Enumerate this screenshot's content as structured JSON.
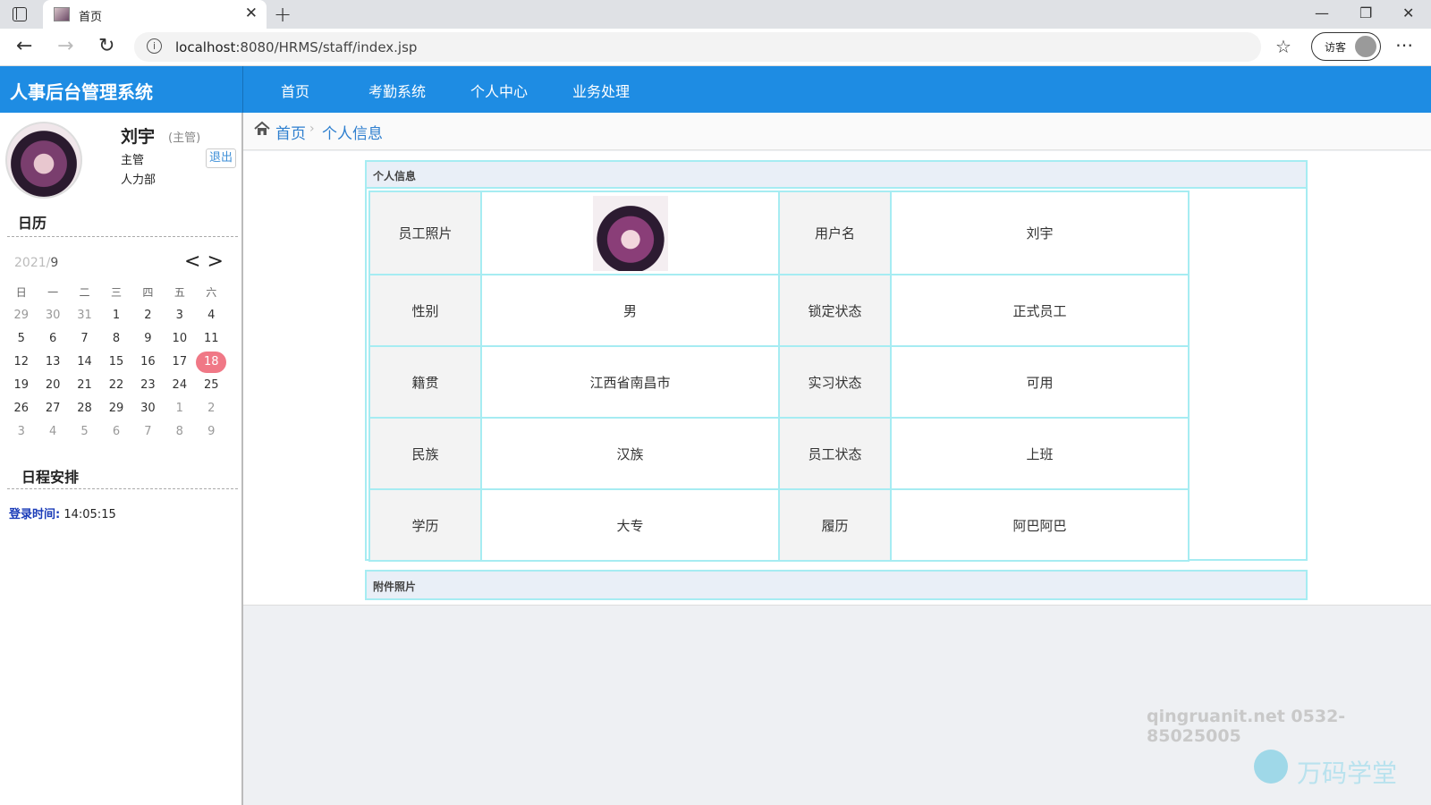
{
  "browser": {
    "tab_title": "首页",
    "url_host": "localhost",
    "url_path": ":8080/HRMS/staff/index.jsp",
    "profile_label": "访客"
  },
  "app": {
    "title": "人事后台管理系统",
    "nav": [
      "首页",
      "考勤系统",
      "个人中心",
      "业务处理"
    ]
  },
  "user": {
    "name": "刘宇",
    "role_tag": "(主管)",
    "role": "主管",
    "dept": "人力部",
    "logout": "退出"
  },
  "calendar": {
    "title": "日历",
    "year": "2021/",
    "month": "9",
    "prev": "<",
    "next": ">",
    "weekdays": [
      "日",
      "一",
      "二",
      "三",
      "四",
      "五",
      "六"
    ],
    "weeks": [
      [
        "29",
        "30",
        "31",
        "1",
        "2",
        "3",
        "4"
      ],
      [
        "5",
        "6",
        "7",
        "8",
        "9",
        "10",
        "11"
      ],
      [
        "12",
        "13",
        "14",
        "15",
        "16",
        "17",
        "18"
      ],
      [
        "19",
        "20",
        "21",
        "22",
        "23",
        "24",
        "25"
      ],
      [
        "26",
        "27",
        "28",
        "29",
        "30",
        "1",
        "2"
      ],
      [
        "3",
        "4",
        "5",
        "6",
        "7",
        "8",
        "9"
      ]
    ],
    "today": "18"
  },
  "schedule": {
    "title": "日程安排",
    "login_label": "登录时间:",
    "login_time": "14:05:15"
  },
  "breadcrumb": {
    "home": "首页",
    "current": "个人信息"
  },
  "info_panel": {
    "title": "个人信息",
    "photo_label": "员工照片",
    "rows": [
      {
        "l1": "员工照片",
        "v1": "",
        "l2": "用户名",
        "v2": "刘宇"
      },
      {
        "l1": "性别",
        "v1": "男",
        "l2": "锁定状态",
        "v2": "正式员工"
      },
      {
        "l1": "籍贯",
        "v1": "江西省南昌市",
        "l2": "实习状态",
        "v2": "可用"
      },
      {
        "l1": "民族",
        "v1": "汉族",
        "l2": "员工状态",
        "v2": "上班"
      },
      {
        "l1": "学历",
        "v1": "大专",
        "l2": "履历",
        "v2": "阿巴阿巴"
      }
    ]
  },
  "attach_panel": {
    "title": "附件照片"
  },
  "watermark": {
    "contact": "qingruanit.net 0532-85025005",
    "brand": "万码学堂"
  }
}
